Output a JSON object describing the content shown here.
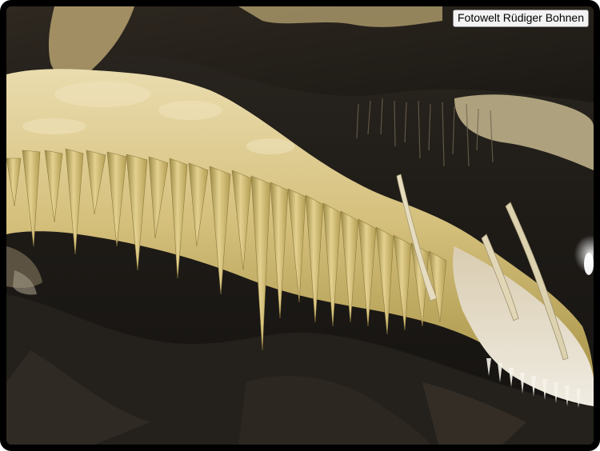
{
  "photo": {
    "subject": "cave-stalactites",
    "credit_text": "Fotowelt Rüdiger Bohnen"
  },
  "palette": {
    "rock_dark": "#1c1a17",
    "rock_mid": "#3a342c",
    "flowstone_light": "#e8d9a6",
    "flowstone_mid": "#c9b06a",
    "flowstone_shadow": "#8a7a45",
    "crystal_white": "#f1ede2",
    "frame": "#000000"
  }
}
